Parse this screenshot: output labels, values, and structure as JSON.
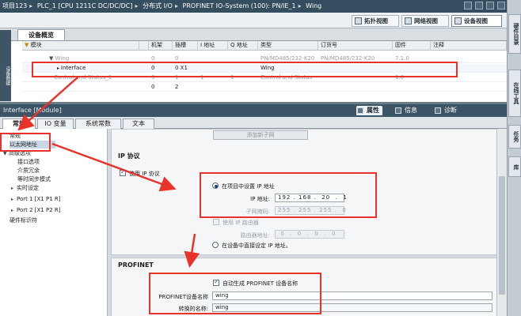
{
  "breadcrumb": [
    "项目123",
    "PLC_1 [CPU 1211C DC/DC/DC]",
    "分布式 I/O",
    "PROFINET IO-System (100): PN/IE_1",
    "Wing"
  ],
  "views": {
    "topology": "拓扑视图",
    "network": "网络视图",
    "device": "设备视图"
  },
  "left_strip_label": "设备数据",
  "right_tabs": [
    "硬件目录",
    "在线工具",
    "任务",
    "库"
  ],
  "overview": {
    "tab": "设备概览",
    "columns": [
      "模块",
      "",
      "机架",
      "插槽",
      "I 地址",
      "Q 地址",
      "类型",
      "订货号",
      "固件",
      "注释"
    ],
    "rows": [
      {
        "name": "Wing",
        "rack": "0",
        "slot": "0",
        "i": "",
        "q": "",
        "type": "PN/MD485/232-K20",
        "order": "PN/MD485/232-K20",
        "fw": "7.1.0",
        "comment": ""
      },
      {
        "name": "Interface",
        "rack": "0",
        "slot": "0 X1",
        "i": "",
        "q": "",
        "type": "Wing",
        "order": "",
        "fw": "",
        "comment": ""
      },
      {
        "name": "Control and Status_1",
        "rack": "0",
        "slot": "1",
        "i": "1",
        "q": "1",
        "type": "Control and Status",
        "order": "",
        "fw": "1.0",
        "comment": ""
      },
      {
        "name": "",
        "rack": "0",
        "slot": "2",
        "i": "",
        "q": "",
        "type": "",
        "order": "",
        "fw": "",
        "comment": ""
      }
    ]
  },
  "inspector": {
    "title": "Interface [Module]",
    "tabs": [
      "属性",
      "信息",
      "诊断"
    ],
    "subtabs": [
      "常规",
      "IO 变量",
      "系统常数",
      "文本"
    ],
    "nav": [
      "常规",
      "以太网地址",
      "高级选项",
      "接口选项",
      "介质冗余",
      "等时同步模式",
      "实时设定",
      "Port 1 [X1 P1 R]",
      "Port 2 [X1 P2 R]",
      "硬件标识符"
    ]
  },
  "ip_section": {
    "add_subnet": "添加新子网",
    "header": "IP 协议",
    "use_ip": "使用 IP 协议",
    "set_in_project": "在项目中设置 IP 地址",
    "ip_label": "IP 地址:",
    "ip_value": "192 . 168 .  20  .  1",
    "mask_label": "子网掩码:",
    "mask_value": "255 . 255 . 255 .  0",
    "use_router": "使用 IP 路由器",
    "router_label": "路由器地址:",
    "router_value": " 0  .  0  .  0  .  0",
    "set_on_device": "在设备中直接设定 IP 地址。"
  },
  "profinet": {
    "header": "PROFINET",
    "auto_name": "自动生成 PROFINET 设备名称",
    "name_label": "PROFINET设备名称",
    "name_value": "wing",
    "converted_label": "转换的名称:",
    "converted_value": "wing"
  },
  "colors": {
    "annotation": "#e8332a",
    "title_bar": "#354e5f"
  }
}
